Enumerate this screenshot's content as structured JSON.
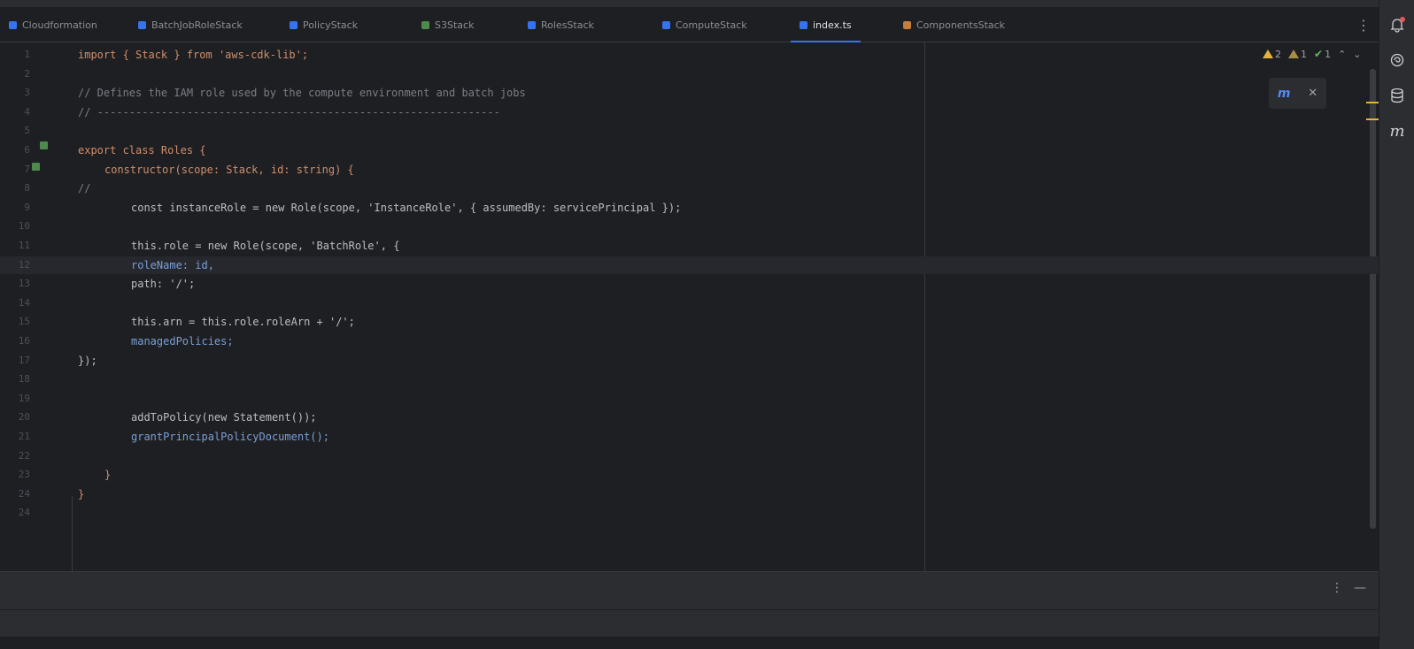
{
  "tabs": [
    {
      "label": "Cloudformation",
      "color": "#3574f0"
    },
    {
      "label": "BatchJobRoleStack",
      "color": "#3574f0"
    },
    {
      "label": "PolicyStack",
      "color": "#3574f0"
    },
    {
      "label": "S3Stack",
      "color": "#4e8a4f"
    },
    {
      "label": "RolesStack",
      "color": "#3574f0"
    },
    {
      "label": "ComputeStack",
      "color": "#3574f0"
    },
    {
      "label": "index.ts",
      "color": "#3574f0",
      "active": true
    },
    {
      "label": "ComponentsStack",
      "color": "#c77d3b"
    }
  ],
  "editor": {
    "lines": [
      {
        "n": "1",
        "text": "import { Stack } from 'aws-cdk-lib';",
        "indent": 0,
        "color": "#cf8e6d"
      },
      {
        "n": "2",
        "text": "",
        "indent": 0,
        "color": "#bcbec4"
      },
      {
        "n": "3",
        "text": "// Defines the IAM role used by the compute environment and batch jobs",
        "indent": 0,
        "color": "#7a7e85"
      },
      {
        "n": "4",
        "text": "// ---------------------------------------------------------------",
        "indent": 0,
        "color": "#7a7e85"
      },
      {
        "n": "5",
        "text": "",
        "indent": 0,
        "color": "#bcbec4"
      },
      {
        "n": "6",
        "text": "export class Roles {",
        "indent": 0,
        "color": "#cf8e6d"
      },
      {
        "n": "7",
        "text": "constructor(scope: Stack, id: string) {",
        "indent": 2,
        "color": "#cf8e6d"
      },
      {
        "n": "8",
        "text": "//",
        "indent": 0,
        "color": "#7a7e85"
      },
      {
        "n": "9",
        "text": "const instanceRole = new Role(scope, 'InstanceRole', { assumedBy: servicePrincipal });",
        "indent": 4,
        "color": "#bcbec4"
      },
      {
        "n": "10",
        "text": "",
        "indent": 0,
        "color": "#bcbec4"
      },
      {
        "n": "11",
        "text": "this.role = new Role(scope, 'BatchRole', {",
        "indent": 4,
        "color": "#bcbec4"
      },
      {
        "n": "12",
        "text": "roleName: id,",
        "indent": 4,
        "color": "#7a9fd6",
        "current": true
      },
      {
        "n": "13",
        "text": "path: '/';",
        "indent": 4,
        "color": "#bcbec4"
      },
      {
        "n": "14",
        "text": "",
        "indent": 0,
        "color": "#bcbec4"
      },
      {
        "n": "15",
        "text": "this.arn = this.role.roleArn + '/';",
        "indent": 4,
        "color": "#bcbec4"
      },
      {
        "n": "16",
        "text": "managedPolicies;",
        "indent": 4,
        "color": "#7a9fd6"
      },
      {
        "n": "17",
        "text": "});",
        "indent": 0,
        "color": "#bcbec4"
      },
      {
        "n": "18",
        "text": "",
        "indent": 0,
        "color": "#bcbec4"
      },
      {
        "n": "19",
        "text": "",
        "indent": 0,
        "color": "#bcbec4"
      },
      {
        "n": "20",
        "text": "addToPolicy(new Statement());",
        "indent": 4,
        "color": "#bcbec4"
      },
      {
        "n": "21",
        "text": "grantPrincipalPolicyDocument();",
        "indent": 4,
        "color": "#7a9fd6"
      },
      {
        "n": "22",
        "text": "",
        "indent": 0,
        "color": "#bcbec4"
      },
      {
        "n": "23",
        "text": "}",
        "indent": 2,
        "color": "#cf8e6d"
      },
      {
        "n": "24",
        "text": "}",
        "indent": 0,
        "color": "#cf8e6d"
      },
      {
        "n": "24",
        "text": "",
        "indent": 0,
        "color": "#bcbec4"
      }
    ]
  },
  "inspections": {
    "warnings": "2",
    "weak_warnings": "1",
    "ok": "1"
  },
  "icons": {
    "more": "more-vertical-icon",
    "bell": "notifications-icon",
    "ai": "ai-assistant-icon",
    "database": "database-icon",
    "m": "m-plugin-icon"
  }
}
